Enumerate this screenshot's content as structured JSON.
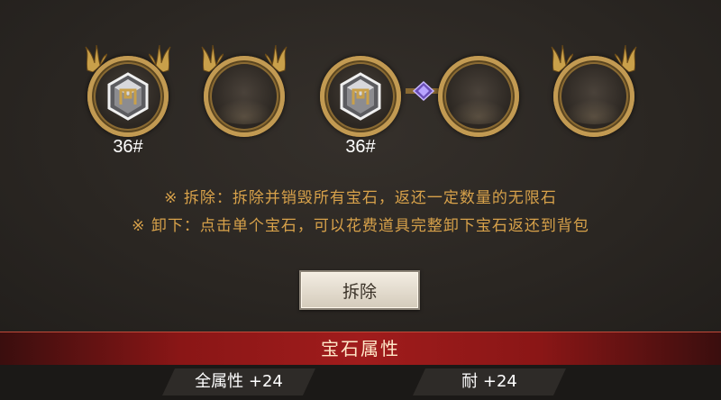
{
  "slots": [
    {
      "filled": true,
      "label": "36#"
    },
    {
      "filled": false,
      "label": ""
    },
    {
      "filled": true,
      "label": "36#"
    },
    {
      "filled": false,
      "label": ""
    },
    {
      "filled": false,
      "label": ""
    }
  ],
  "info": {
    "line1": "※ 拆除：拆除并销毁所有宝石，返还一定数量的无限石",
    "line2": "※ 卸下：点击单个宝石，可以花费道具完整卸下宝石返还到背包"
  },
  "button": {
    "dismantle_label": "拆除"
  },
  "attributes": {
    "header": "宝石属性",
    "items": [
      "全属性 +24",
      "耐 +24"
    ]
  },
  "colors": {
    "gold_rim": "#c29a52",
    "info_text": "#d7a14a",
    "header_red": "#a01c1c"
  },
  "icons": {
    "gem": "gem-icon",
    "crown": "crown-ornament-icon",
    "link": "link-crystal-icon"
  }
}
